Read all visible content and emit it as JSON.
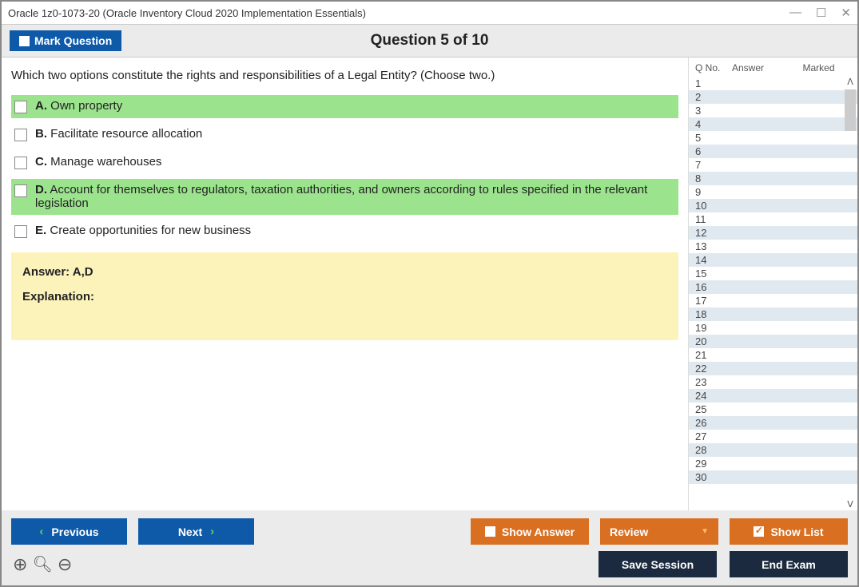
{
  "window": {
    "title": "Oracle 1z0-1073-20 (Oracle Inventory Cloud 2020 Implementation Essentials)"
  },
  "header": {
    "mark_label": "Mark Question",
    "question_title": "Question 5 of 10"
  },
  "question": {
    "text": "Which two options constitute the rights and responsibilities of a Legal Entity? (Choose two.)",
    "options": {
      "a": {
        "letter": "A.",
        "text": " Own property"
      },
      "b": {
        "letter": "B.",
        "text": " Facilitate resource allocation"
      },
      "c": {
        "letter": "C.",
        "text": " Manage warehouses"
      },
      "d": {
        "letter": "D.",
        "text": " Account for themselves to regulators, taxation authorities, and owners according to rules specified in the relevant legislation"
      },
      "e": {
        "letter": "E.",
        "text": " Create opportunities for new business"
      }
    },
    "answer_label": "Answer: A,D",
    "explanation_label": "Explanation:"
  },
  "side": {
    "head_qno": "Q No.",
    "head_answer": "Answer",
    "head_marked": "Marked",
    "rows": [
      "1",
      "2",
      "3",
      "4",
      "5",
      "6",
      "7",
      "8",
      "9",
      "10",
      "11",
      "12",
      "13",
      "14",
      "15",
      "16",
      "17",
      "18",
      "19",
      "20",
      "21",
      "22",
      "23",
      "24",
      "25",
      "26",
      "27",
      "28",
      "29",
      "30"
    ]
  },
  "footer": {
    "previous": "Previous",
    "next": "Next",
    "show_answer": "Show Answer",
    "review": "Review",
    "show_list": "Show List",
    "save_session": "Save Session",
    "end_exam": "End Exam"
  }
}
